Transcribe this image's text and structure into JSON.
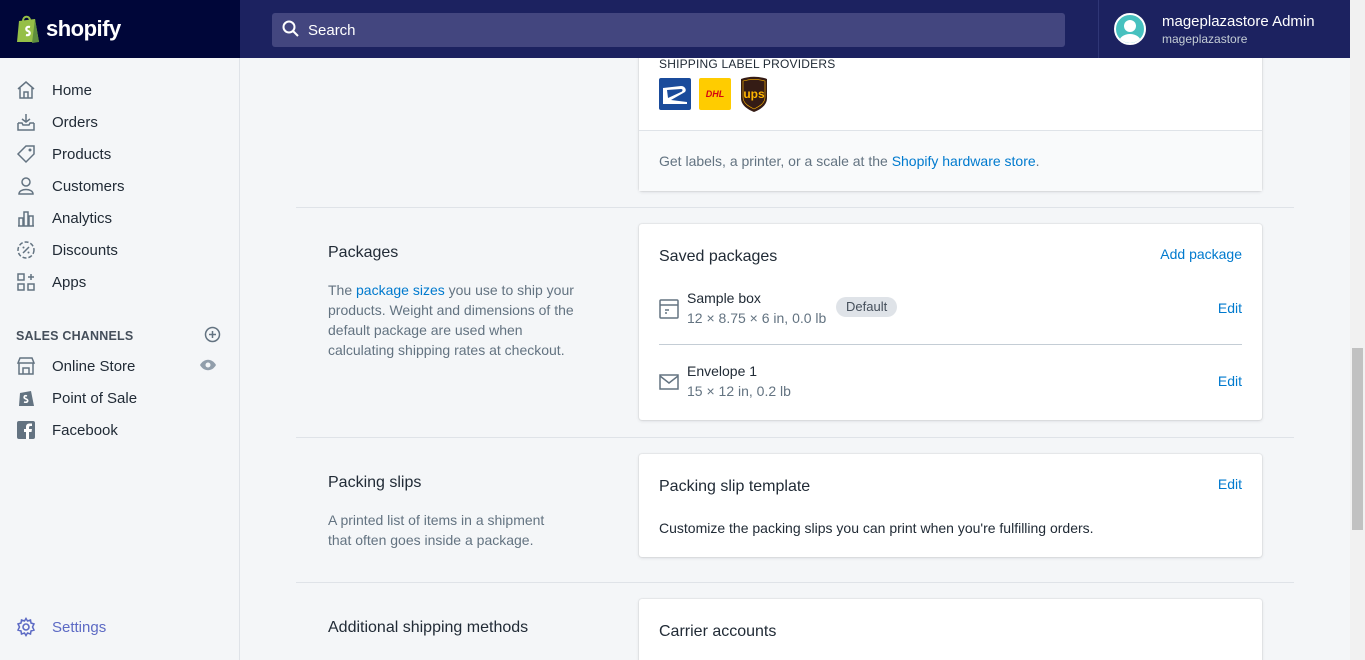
{
  "brand": {
    "name": "shopify"
  },
  "search": {
    "placeholder": "Search"
  },
  "user": {
    "name": "mageplazastore Admin",
    "store": "mageplazastore"
  },
  "sidebar": {
    "items": [
      {
        "label": "Home",
        "icon": "home-icon"
      },
      {
        "label": "Orders",
        "icon": "orders-icon"
      },
      {
        "label": "Products",
        "icon": "tag-icon"
      },
      {
        "label": "Customers",
        "icon": "person-icon"
      },
      {
        "label": "Analytics",
        "icon": "analytics-icon"
      },
      {
        "label": "Discounts",
        "icon": "discount-icon"
      },
      {
        "label": "Apps",
        "icon": "apps-icon"
      }
    ],
    "sales_channels_header": "SALES CHANNELS",
    "channels": [
      {
        "label": "Online Store",
        "icon": "store-icon"
      },
      {
        "label": "Point of Sale",
        "icon": "pos-icon"
      },
      {
        "label": "Facebook",
        "icon": "facebook-icon"
      }
    ],
    "settings_label": "Settings"
  },
  "shipping_labels": {
    "providers_heading": "SHIPPING LABEL PROVIDERS",
    "dhl_text": "DHL",
    "ups_text": "ups",
    "footer_prefix": "Get labels, a printer, or a scale at the ",
    "footer_link": "Shopify hardware store",
    "footer_suffix": "."
  },
  "packages": {
    "title": "Packages",
    "desc_prefix": "The ",
    "desc_link": "package sizes",
    "desc_suffix": " you use to ship your products. Weight and dimensions of the default package are used when calculating shipping rates at checkout.",
    "card_title": "Saved packages",
    "add_label": "Add package",
    "items": [
      {
        "name": "Sample box",
        "dims": "12 × 8.75 × 6 in, 0.0 lb",
        "badge": "Default",
        "edit": "Edit"
      },
      {
        "name": "Envelope 1",
        "dims": "15 × 12 in, 0.2 lb",
        "edit": "Edit"
      }
    ]
  },
  "packing_slips": {
    "title": "Packing slips",
    "desc": "A printed list of items in a shipment that often goes inside a package.",
    "card_title": "Packing slip template",
    "edit": "Edit",
    "card_desc": "Customize the packing slips you can print when you're fulfilling orders."
  },
  "additional": {
    "title": "Additional shipping methods",
    "card_title": "Carrier accounts"
  }
}
